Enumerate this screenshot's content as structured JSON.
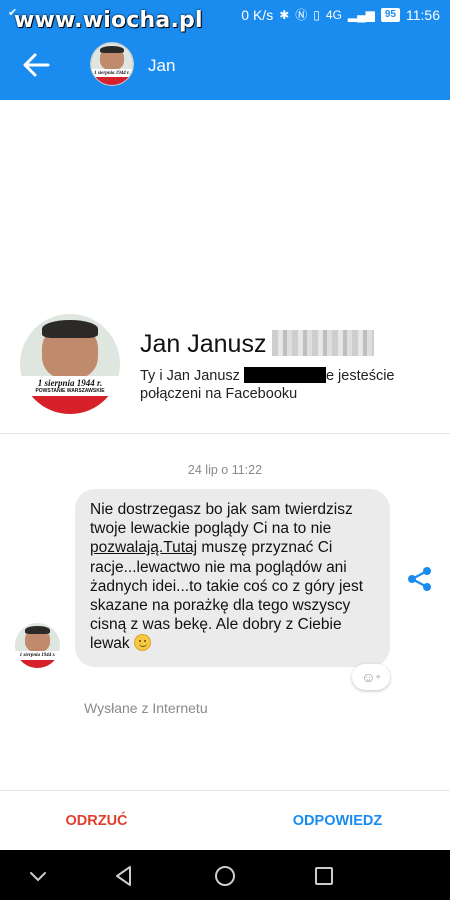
{
  "status_bar": {
    "watermark": "www.wiocha.pl",
    "speed": "0 K/s",
    "network": "4G",
    "battery": "95",
    "time": "11:56"
  },
  "header": {
    "contact_name": "Jan",
    "accent_color": "#1a8cf0"
  },
  "profile": {
    "name": "Jan Janusz",
    "desc_part1": "Ty i Jan Janusz",
    "desc_part2": "e jesteście",
    "desc_part3": "połączeni na Facebooku",
    "avatar_caption": "1 sierpnia 1944 r.",
    "avatar_subcaption": "POWSTANIE WARSZAWSKIE"
  },
  "conversation": {
    "timestamp": "24 lip o 11:22",
    "message": {
      "part1": "Nie dostrzegasz bo jak sam twierdzisz twoje lewackie poglądy Ci na to nie ",
      "link1": "pozwalają.Tutaj",
      "part2": " muszę przyznać Ci racje...lewactwo nie ma poglądów ani żadnych idei...to takie coś co z góry jest skazane na porażkę dla tego wszyscy cisną z was bekę. Ale dobry z Ciebie lewak "
    },
    "sent_via": "Wysłane z Internetu"
  },
  "actions": {
    "decline": "ODRZUĆ",
    "reply": "ODPOWIEDZ"
  },
  "icons": {
    "back": "arrow-left-icon",
    "share": "share-icon",
    "react": "add-reaction-icon",
    "nav_down": "chevron-down-icon",
    "nav_back": "triangle-back-icon",
    "nav_home": "circle-home-icon",
    "nav_recent": "square-recents-icon"
  }
}
